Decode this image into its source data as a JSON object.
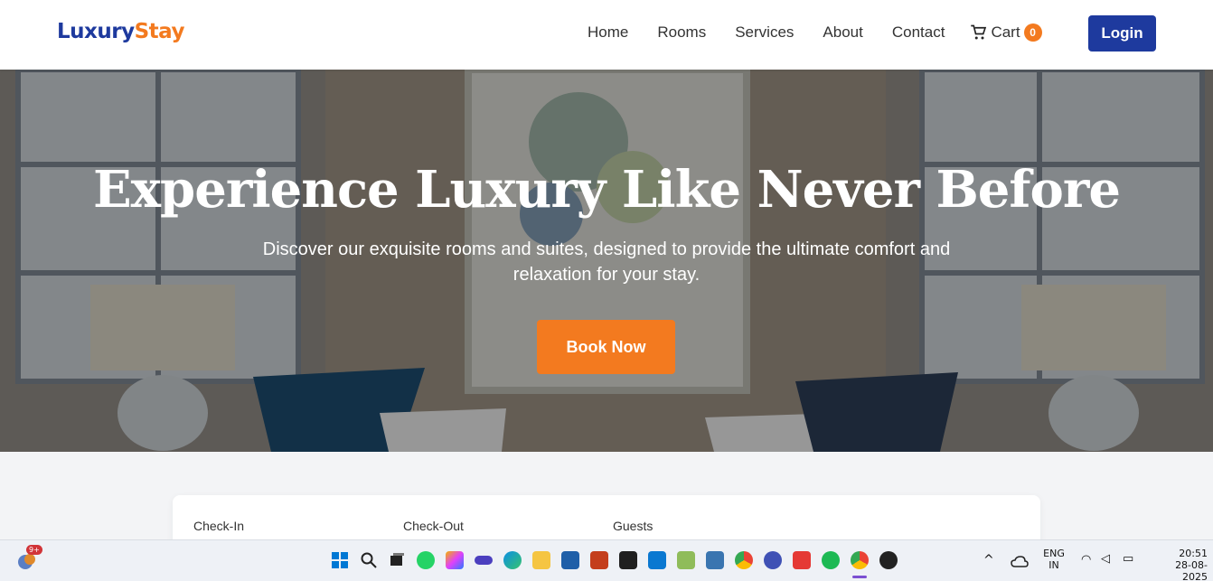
{
  "header": {
    "logo_part1": "Luxury",
    "logo_part2": "Stay",
    "nav": [
      "Home",
      "Rooms",
      "Services",
      "About",
      "Contact"
    ],
    "cart_label": "Cart",
    "cart_count": "0",
    "login_label": "Login"
  },
  "hero": {
    "title": "Experience Luxury Like Never Before",
    "subtitle": "Discover our exquisite rooms and suites, designed to provide the ultimate comfort and relaxation for your stay.",
    "cta_label": "Book Now"
  },
  "booking": {
    "checkin_label": "Check-In",
    "checkout_label": "Check-Out",
    "guests_label": "Guests"
  },
  "taskbar": {
    "notification_badge": "9+",
    "lang_line1": "ENG",
    "lang_line2": "IN",
    "time": "20:51",
    "date": "28-08-2025"
  },
  "colors": {
    "brand_blue": "#1e3a9e",
    "brand_orange": "#f37a1f"
  }
}
